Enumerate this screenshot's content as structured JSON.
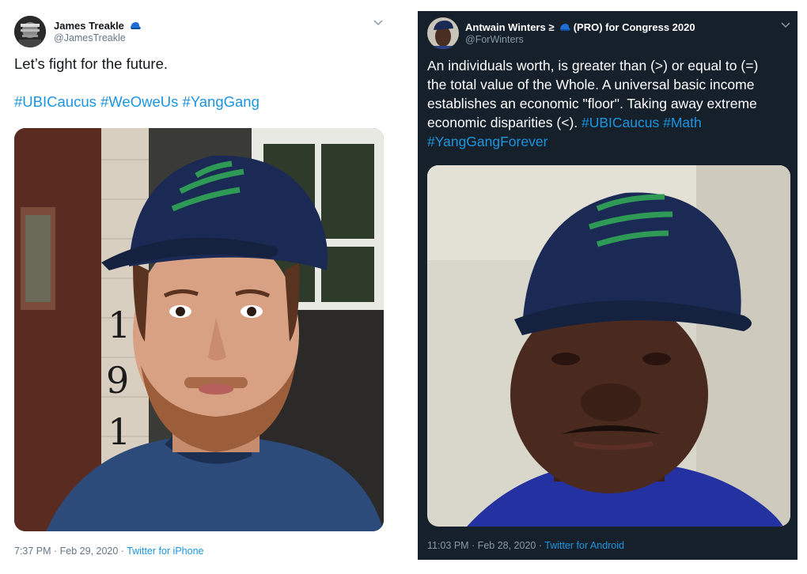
{
  "tweets": [
    {
      "name": "James Treakle",
      "handle": "@JamesTreakle",
      "text": "Let’s fight for the future.",
      "hashtags": "#UBICaucus #WeOweUs #YangGang",
      "time": "7:37 PM · Feb 29, 2020 · ",
      "source": "Twitter for iPhone",
      "name_badge_icon": "blue-cap-icon",
      "menu_icon": "chevron-down-icon"
    },
    {
      "name": "Antwain Winters ≥",
      "name_suffix": "(PRO) for Congress 2020",
      "handle": "@ForWinters",
      "text_lines": [
        "An individuals worth, is greater than (>) or equal to (=)",
        "the total value of the Whole. A universal basic income",
        "establishes an economic \"floor\". Taking away extreme",
        "economic disparities (<). "
      ],
      "hashtags_inline": "#UBICaucus #Math",
      "hashtag_last": "#YangGangForever",
      "time": "11:03 PM · Feb 28, 2020 · ",
      "source": "Twitter for Android",
      "name_badge_icon": "blue-cap-icon",
      "menu_icon": "chevron-down-icon"
    }
  ],
  "colors": {
    "link": "#1b95e0",
    "dark_bg": "#15202b",
    "light_bg": "#ffffff",
    "cap_navy": "#1b2a55",
    "cap_stripe": "#2f9a55"
  }
}
